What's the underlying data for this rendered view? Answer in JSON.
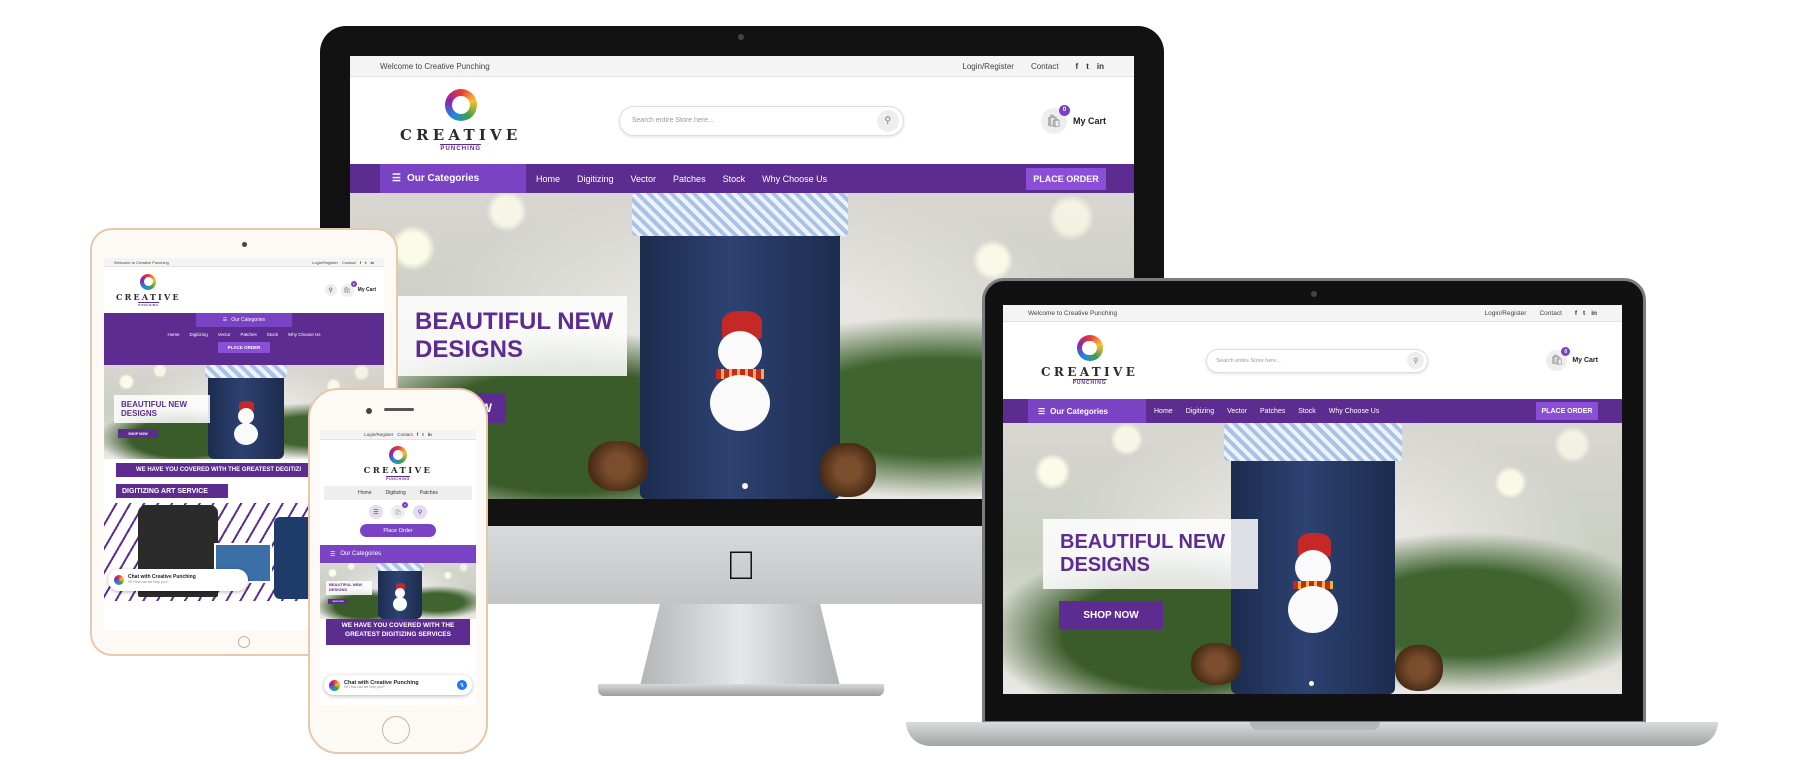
{
  "site": {
    "welcome": "Welcome to Creative Punching",
    "login": "Login/Register",
    "contact": "Contact",
    "social": [
      "f",
      "t",
      "in"
    ],
    "logo_word": "CREATIVE",
    "logo_sub": "PUNCHING",
    "search_placeholder": "Search entire Store here...",
    "cart_count": "0",
    "cart_label": "My Cart",
    "categories_label": "Our Categories",
    "nav": [
      "Home",
      "Digitizing",
      "Vector",
      "Patches",
      "Stock",
      "Why Choose Us"
    ],
    "place_order": "PLACE ORDER",
    "place_order_mobile": "Place Order",
    "hero_line1": "BEAUTIFUL NEW",
    "hero_line2": "DESIGNS",
    "shop_now": "SHOP NOW",
    "shop_now_partial": "OP NOW",
    "banner_text": "WE HAVE YOU COVERED WITH THE GREATEST DIGITIZING SERVICES",
    "banner_text_tablet": "WE HAVE YOU COVERED WITH THE GREATEST DEGITIZI",
    "section_title": "DIGITIZING ART SERVICE",
    "chat_title": "Chat with Creative Punching",
    "chat_sub": "Hi! How can we help you?"
  },
  "colors": {
    "brand_purple": "#5d2c91",
    "accent_purple": "#8a4fd6"
  },
  "icons": [
    "search-icon",
    "cart-icon",
    "menu-icon",
    "apple-logo-icon",
    "messenger-icon",
    "camera-icon"
  ]
}
